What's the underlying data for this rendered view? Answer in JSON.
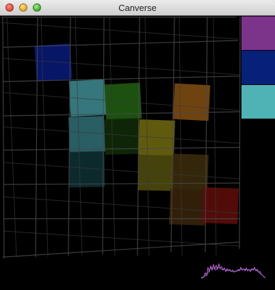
{
  "window": {
    "title": "Canverse"
  },
  "colors": {
    "palette": [
      "#7c338a",
      "#07217a",
      "#4fb2b5"
    ],
    "grid_line": "#555555",
    "waveform_a": "#d36ad2",
    "waveform_b": "#8c6be0"
  },
  "icons": {
    "close": "close-traffic-light-icon",
    "minimize": "minimize-traffic-light-icon",
    "maximize": "zoom-traffic-light-icon"
  }
}
